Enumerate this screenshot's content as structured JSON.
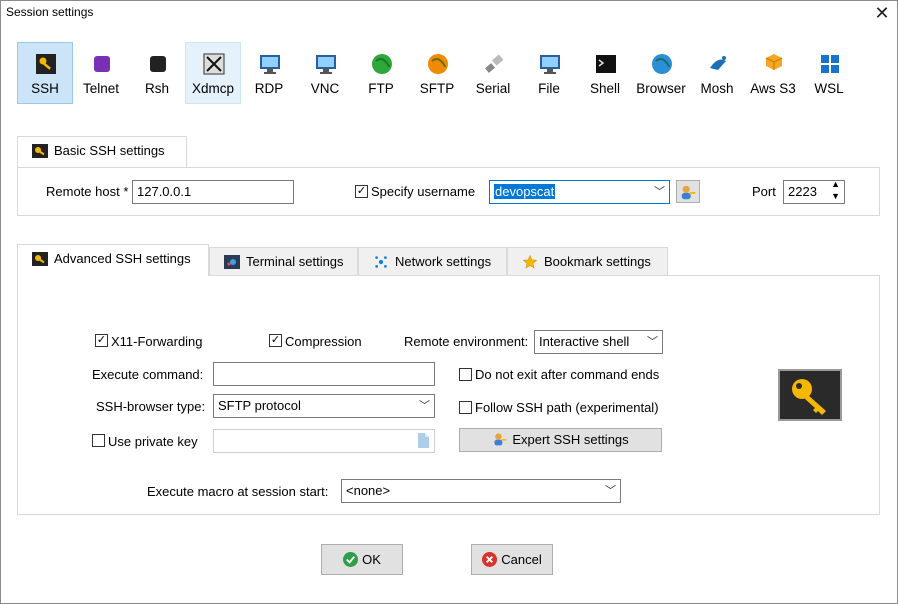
{
  "window": {
    "title": "Session settings",
    "close_icon": "close-icon"
  },
  "toolbar": [
    {
      "label": "SSH",
      "icon": "key-icon"
    },
    {
      "label": "Telnet",
      "icon": "telnet-icon"
    },
    {
      "label": "Rsh",
      "icon": "rsh-icon"
    },
    {
      "label": "Xdmcp",
      "icon": "xdmcp-icon"
    },
    {
      "label": "RDP",
      "icon": "rdp-monitor-icon"
    },
    {
      "label": "VNC",
      "icon": "vnc-monitor-icon"
    },
    {
      "label": "FTP",
      "icon": "ftp-globe-icon"
    },
    {
      "label": "SFTP",
      "icon": "sftp-globe-icon"
    },
    {
      "label": "Serial",
      "icon": "serial-plug-icon"
    },
    {
      "label": "File",
      "icon": "file-monitor-icon"
    },
    {
      "label": "Shell",
      "icon": "shell-terminal-icon"
    },
    {
      "label": "Browser",
      "icon": "browser-globe-icon"
    },
    {
      "label": "Mosh",
      "icon": "satellite-dish-icon"
    },
    {
      "label": "Aws S3",
      "icon": "aws-cubes-icon"
    },
    {
      "label": "WSL",
      "icon": "windows-logo-icon"
    }
  ],
  "basic": {
    "tab_label": "Basic SSH settings",
    "remote_host_label": "Remote host *",
    "remote_host_value": "127.0.0.1",
    "specify_username_label": "Specify username",
    "specify_username_checked": true,
    "username_value": "devopscat",
    "port_label": "Port",
    "port_value": "2223"
  },
  "tabs": [
    {
      "label": "Advanced SSH settings",
      "icon": "key-icon",
      "selected": true
    },
    {
      "label": "Terminal settings",
      "icon": "terminal-icon",
      "selected": false
    },
    {
      "label": "Network settings",
      "icon": "network-icon",
      "selected": false
    },
    {
      "label": "Bookmark settings",
      "icon": "star-icon",
      "selected": false
    }
  ],
  "advanced": {
    "x11_label": "X11-Forwarding",
    "x11_checked": true,
    "compression_label": "Compression",
    "compression_checked": true,
    "remote_env_label": "Remote environment:",
    "remote_env_value": "Interactive shell",
    "execute_command_label": "Execute command:",
    "execute_command_value": "",
    "no_exit_label": "Do not exit after command ends",
    "no_exit_checked": false,
    "browser_type_label": "SSH-browser type:",
    "browser_type_value": "SFTP protocol",
    "follow_path_label": "Follow SSH path (experimental)",
    "follow_path_checked": false,
    "private_key_label": "Use private key",
    "private_key_checked": false,
    "private_key_value": "",
    "expert_button_label": "Expert SSH settings",
    "macro_label": "Execute macro at session start:",
    "macro_value": "<none>"
  },
  "buttons": {
    "ok_label": "OK",
    "cancel_label": "Cancel"
  },
  "colors": {
    "accent": "#cce4f7",
    "ok_green": "#2e9e48",
    "cancel_red": "#d9342b",
    "key_gold": "#f5b800"
  }
}
